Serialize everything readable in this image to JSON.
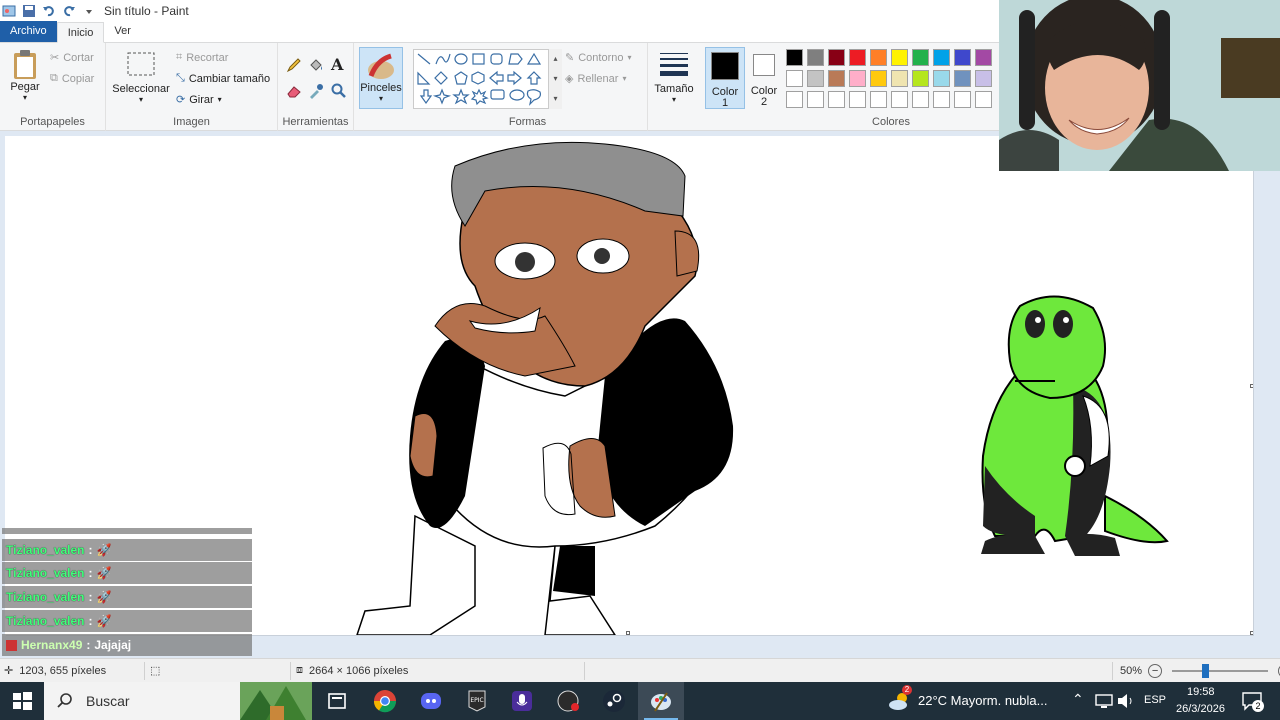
{
  "window": {
    "title": "Sin título - Paint"
  },
  "tabs": [
    {
      "label": "Archivo"
    },
    {
      "label": "Inicio"
    },
    {
      "label": "Ver"
    }
  ],
  "ribbon": {
    "clipboard": {
      "paste": "Pegar",
      "cut": "Cortar",
      "copy": "Copiar",
      "group": "Portapapeles"
    },
    "image": {
      "select": "Seleccionar",
      "crop": "Recortar",
      "resize": "Cambiar tamaño",
      "rotate": "Girar",
      "group": "Imagen"
    },
    "tools": {
      "group": "Herramientas"
    },
    "brushes": {
      "label": "Pinceles"
    },
    "shapes": {
      "outline": "Contorno",
      "fill": "Rellenar",
      "group": "Formas"
    },
    "size": {
      "label": "Tamaño"
    },
    "color1": {
      "label": "Color",
      "sub": "1"
    },
    "color2": {
      "label": "Color",
      "sub": "2"
    },
    "colors": {
      "group": "Colores"
    },
    "palette_row1": [
      "#000000",
      "#7f7f7f",
      "#880015",
      "#ed1c24",
      "#ff7f27",
      "#fff200",
      "#22b14c",
      "#00a2e8",
      "#3f48cc",
      "#a349a4"
    ],
    "palette_row2": [
      "#ffffff",
      "#c3c3c3",
      "#b97a57",
      "#ffaec9",
      "#ffc90e",
      "#efe4b0",
      "#b5e61d",
      "#99d9ea",
      "#7092be",
      "#c8bfe7"
    ]
  },
  "chat": [
    {
      "user": "Tiziano_valen",
      "sep": ":",
      "msg": "🚀"
    },
    {
      "user": "Tiziano_valen",
      "sep": ":",
      "msg": "🚀"
    },
    {
      "user": "Tiziano_valen",
      "sep": ":",
      "msg": "🚀"
    },
    {
      "user": "Tiziano_valen",
      "sep": ":",
      "msg": "🚀"
    },
    {
      "user": "Hernanx49",
      "sep": ":",
      "msg": "Jajajaj"
    }
  ],
  "status": {
    "cursor": "1203, 655 píxeles",
    "size": "2664 × 1066 píxeles",
    "zoom": "50%"
  },
  "taskbar": {
    "search": "Buscar",
    "weather": "22°C  Mayorm. nubla...",
    "lang": "ESP",
    "time": "19:58",
    "date": "26/3/2026",
    "notifications": "2",
    "weather_badge": "2"
  }
}
